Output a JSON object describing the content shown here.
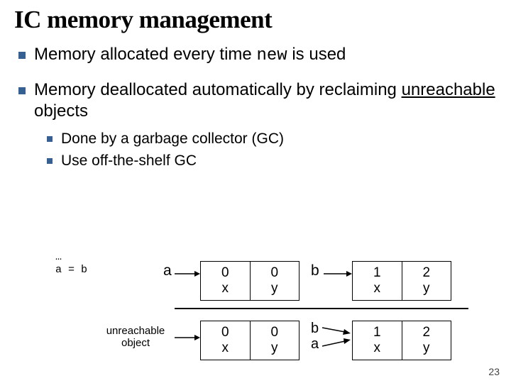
{
  "title": "IC memory management",
  "bullets": [
    {
      "pre": "Memory allocated every time ",
      "kw": "new",
      "post": " is used"
    },
    {
      "pre": "Memory deallocated automatically by reclaiming ",
      "ul": "unreachable",
      "post": " objects"
    }
  ],
  "subbullets": [
    "Done by a garbage collector (GC)",
    "Use off-the-shelf GC"
  ],
  "code": {
    "l1": "…",
    "l2": "a = b"
  },
  "diagram": {
    "ptrA": "a",
    "ptrB": "b",
    "row1": {
      "boxA": {
        "v1": "0",
        "f1": "x",
        "v2": "0",
        "f2": "y"
      },
      "boxB": {
        "v1": "1",
        "f1": "x",
        "v2": "2",
        "f2": "y"
      }
    },
    "unreachable": {
      "l1": "unreachable",
      "l2": "object"
    },
    "row2": {
      "boxA": {
        "v1": "0",
        "f1": "x",
        "v2": "0",
        "f2": "y"
      },
      "ab": {
        "top": "b",
        "bot": "a"
      },
      "boxB": {
        "v1": "1",
        "f1": "x",
        "v2": "2",
        "f2": "y"
      }
    }
  },
  "pageNumber": "23"
}
